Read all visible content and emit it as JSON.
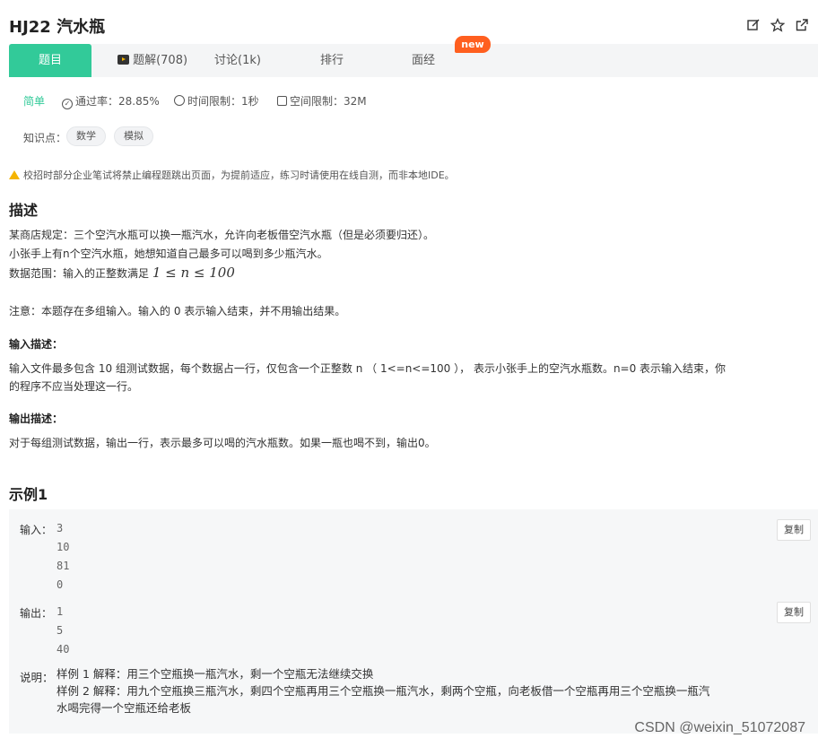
{
  "header": {
    "title": "HJ22  汽水瓶"
  },
  "tabs": [
    {
      "label": "题目"
    },
    {
      "label": "题解(708)"
    },
    {
      "label": "讨论(1k)"
    },
    {
      "label": "排行"
    },
    {
      "label": "面经"
    }
  ],
  "new_badge": "new",
  "meta": {
    "difficulty": "简单",
    "pass_rate": "通过率：28.85%",
    "time_limit": "时间限制：1秒",
    "space_limit": "空间限制：32M"
  },
  "knowledge": {
    "label": "知识点：",
    "tags": [
      "数学",
      "模拟"
    ]
  },
  "warning": "校招时部分企业笔试将禁止编程题跳出页面，为提前适应，练习时请使用在线自测，而非本地IDE。",
  "description": {
    "heading": "描述",
    "line1": "某商店规定：三个空汽水瓶可以换一瓶汽水，允许向老板借空汽水瓶（但是必须要归还）。",
    "line2": "小张手上有n个空汽水瓶，她想知道自己最多可以喝到多少瓶汽水。",
    "line3": "数据范围：输入的正整数满足",
    "range_formula": "1 ≤ n ≤ 100",
    "note": "注意：本题存在多组输入。输入的 0 表示输入结束，并不用输出结果。"
  },
  "input_desc": {
    "heading": "输入描述：",
    "text1": "输入文件最多包含 10 组测试数据，每个数据占一行，仅包含一个正整数 n （ 1<=n<=100 ）， 表示小张手上的空汽水瓶数。n=0 表示输入结束，你",
    "text2": "的程序不应当处理这一行。"
  },
  "output_desc": {
    "heading": "输出描述：",
    "text": "对于每组测试数据，输出一行，表示最多可以喝的汽水瓶数。如果一瓶也喝不到，输出0。"
  },
  "example": {
    "heading": "示例1",
    "input_label": "输入：",
    "input_lines": [
      "3",
      "10",
      "81",
      "0"
    ],
    "output_label": "输出：",
    "output_lines": [
      "1",
      "5",
      "40"
    ],
    "copy_label": "复制",
    "explain_label": "说明：",
    "explain1": "样例 1 解释：用三个空瓶换一瓶汽水，剩一个空瓶无法继续交换",
    "explain2a": "样例 2 解释：用九个空瓶换三瓶汽水，剩四个空瓶再用三个空瓶换一瓶汽水，剩两个空瓶，向老板借一个空瓶再用三个空瓶换一瓶汽",
    "explain2b": "水喝完得一个空瓶还给老板"
  },
  "watermark": "CSDN @weixin_51072087",
  "colors": {
    "accent": "#32ca99",
    "badge": "#ff5f1f",
    "warn": "#f5b400"
  }
}
